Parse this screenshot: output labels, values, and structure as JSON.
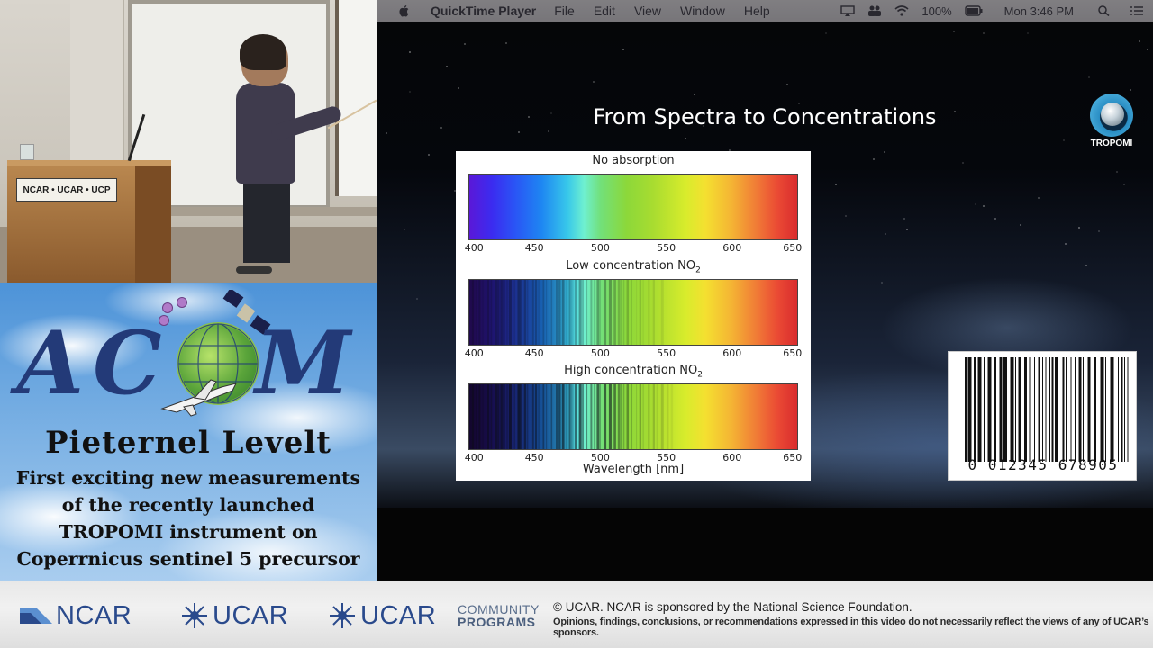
{
  "camera": {
    "podium_label": "NCAR • UCAR • UCP"
  },
  "title_card": {
    "logo_text": "ACOM",
    "logo_letters": [
      "A",
      "C",
      "O",
      "M"
    ],
    "presenter": "Pieternel Levelt",
    "talk_title_lines": [
      "First exciting new measurements",
      "of the recently launched",
      "TROPOMI instrument on",
      "Coperrnicus sentinel 5 precursor"
    ]
  },
  "menubar": {
    "app_name": "QuickTime Player",
    "menus": [
      "File",
      "Edit",
      "View",
      "Window",
      "Help"
    ],
    "battery": "100%",
    "clock": "Mon 3:46 PM",
    "icons": [
      "apple-icon",
      "airplay-icon",
      "user-icon",
      "wifi-icon",
      "battery-icon",
      "search-icon",
      "list-icon"
    ]
  },
  "slide": {
    "title": "From Spectra to Concentrations",
    "tropomi_logo_label": "TROPOMI",
    "panels": [
      {
        "label": "No absorption",
        "subscript": ""
      },
      {
        "label": "Low concentration NO",
        "subscript": "2"
      },
      {
        "label": "High concentration NO",
        "subscript": "2"
      }
    ],
    "tick_labels": [
      "400",
      "450",
      "500",
      "550",
      "600",
      "650"
    ],
    "xlabel": "Wavelength [nm]",
    "barcode_digits": "0 012345 678905"
  },
  "chart_data": {
    "type": "heatmap",
    "title": "From Spectra to Concentrations",
    "xlabel": "Wavelength [nm]",
    "xlim": [
      400,
      650
    ],
    "x_ticks": [
      400,
      450,
      500,
      550,
      600,
      650
    ],
    "series": [
      {
        "name": "No absorption",
        "absorption_strength": 0
      },
      {
        "name": "Low concentration NO2",
        "absorption_strength": 0.45
      },
      {
        "name": "High concentration NO2",
        "absorption_strength": 0.85
      }
    ]
  },
  "footer": {
    "logos": [
      "NCAR",
      "UCAR",
      "UCAR"
    ],
    "community_line1": "COMMUNITY",
    "community_line2": "PROGRAMS",
    "copyright": "© UCAR. NCAR is sponsored by the National Science Foundation.",
    "disclaimer": "Opinions, findings, conclusions, or recommendations expressed in this video do not necessarily reflect the views of any of UCAR’s sponsors.",
    "colors": {
      "brand_blue": "#2a4a8c"
    }
  }
}
